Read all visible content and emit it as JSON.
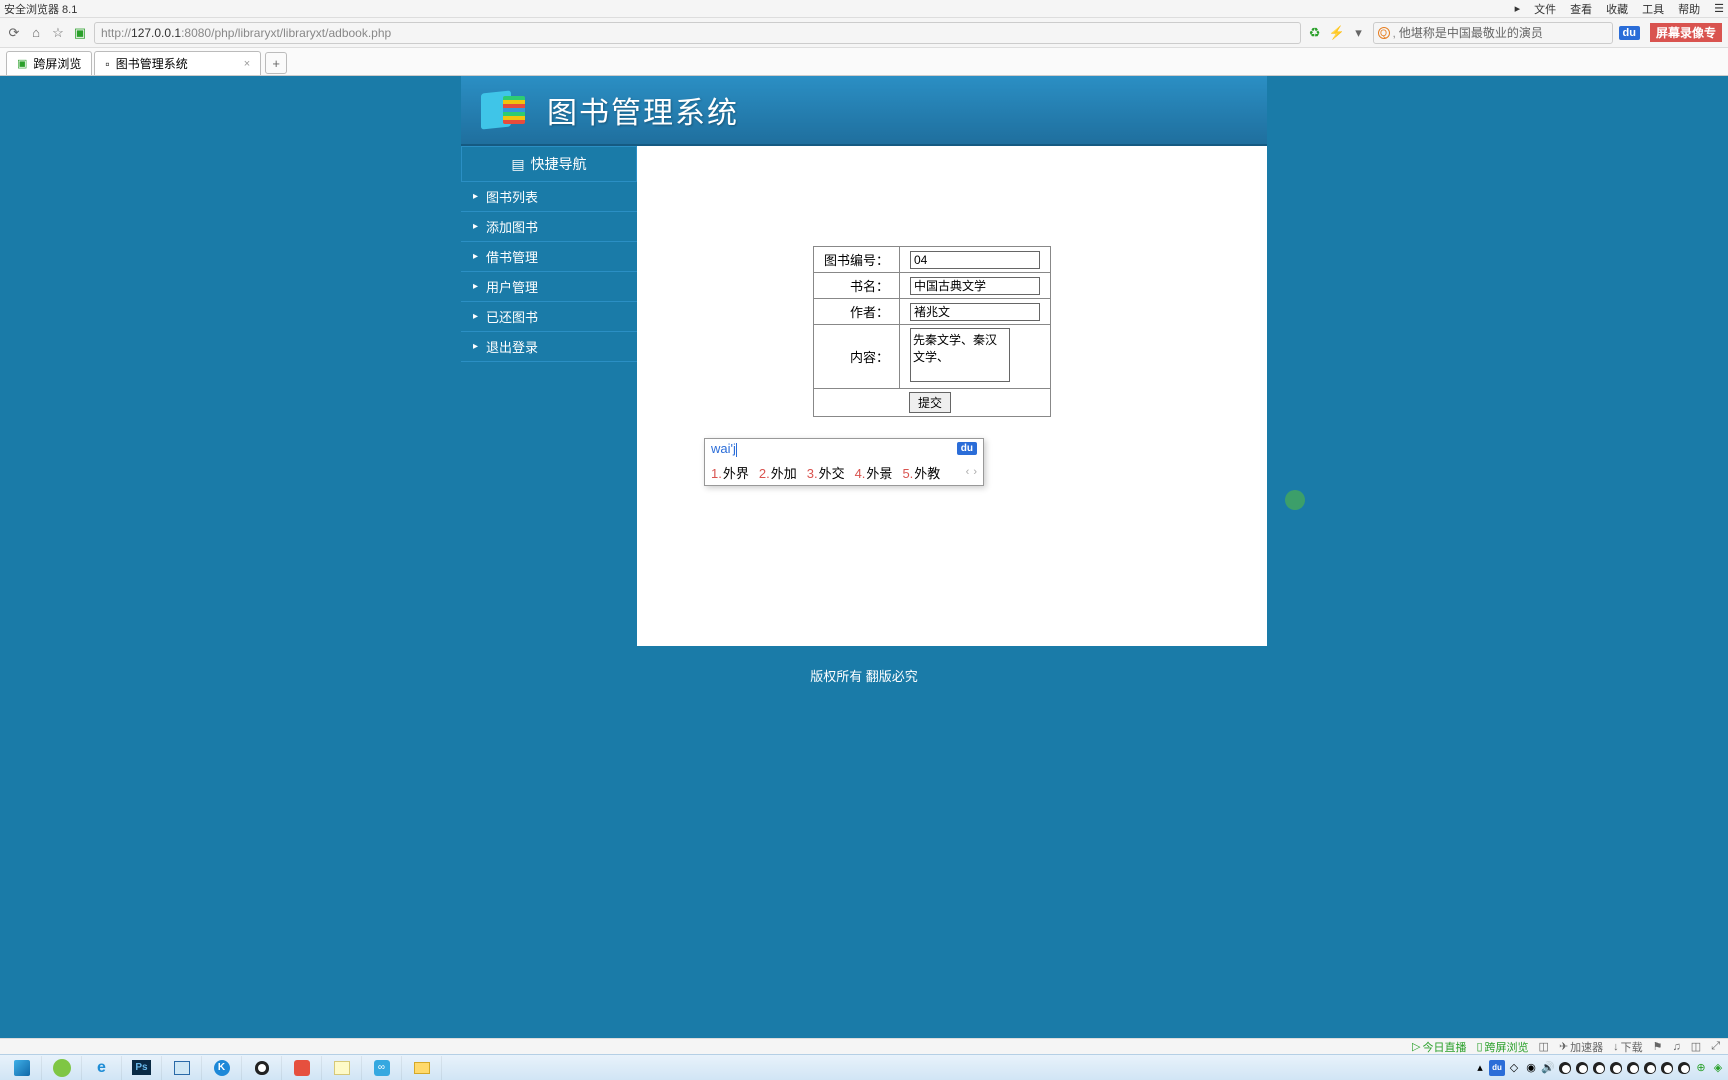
{
  "browser": {
    "title": "安全浏览器 8.1",
    "menus": [
      "文件",
      "查看",
      "收藏",
      "工具",
      "帮助"
    ],
    "url_prefix": "http://",
    "url_host": "127.0.0.1",
    "url_port": ":8080",
    "url_path": "/php/libraryxt/libraryxt/adbook.php",
    "search_placeholder": "他堪称是中国最敬业的演员",
    "du_label": "du",
    "record_label": "屏幕录像专"
  },
  "tabs": [
    {
      "label": "跨屏浏览"
    },
    {
      "label": "图书管理系统"
    }
  ],
  "app": {
    "title": "图书管理系统",
    "sidebar_title": "快捷导航",
    "sidebar_items": [
      "图书列表",
      "添加图书",
      "借书管理",
      "用户管理",
      "已还图书",
      "退出登录"
    ]
  },
  "form": {
    "book_id_label": "图书编号：",
    "book_id_value": "04",
    "name_label": "书名：",
    "name_value": "中国古典文学",
    "author_label": "作者：",
    "author_value": "褚兆文",
    "content_label": "内容：",
    "content_value": "先秦文学、秦汉文学、",
    "submit": "提交"
  },
  "ime": {
    "typed": "wai'j",
    "du": "du",
    "candidates": [
      {
        "n": "1.",
        "w": "外界"
      },
      {
        "n": "2.",
        "w": "外加"
      },
      {
        "n": "3.",
        "w": "外交"
      },
      {
        "n": "4.",
        "w": "外景"
      },
      {
        "n": "5.",
        "w": "外教"
      }
    ]
  },
  "footer": "版权所有 翻版必究",
  "statusbar": {
    "live": "今日直播",
    "cross": "跨屏浏览",
    "accel": "加速器",
    "download": "下载"
  }
}
